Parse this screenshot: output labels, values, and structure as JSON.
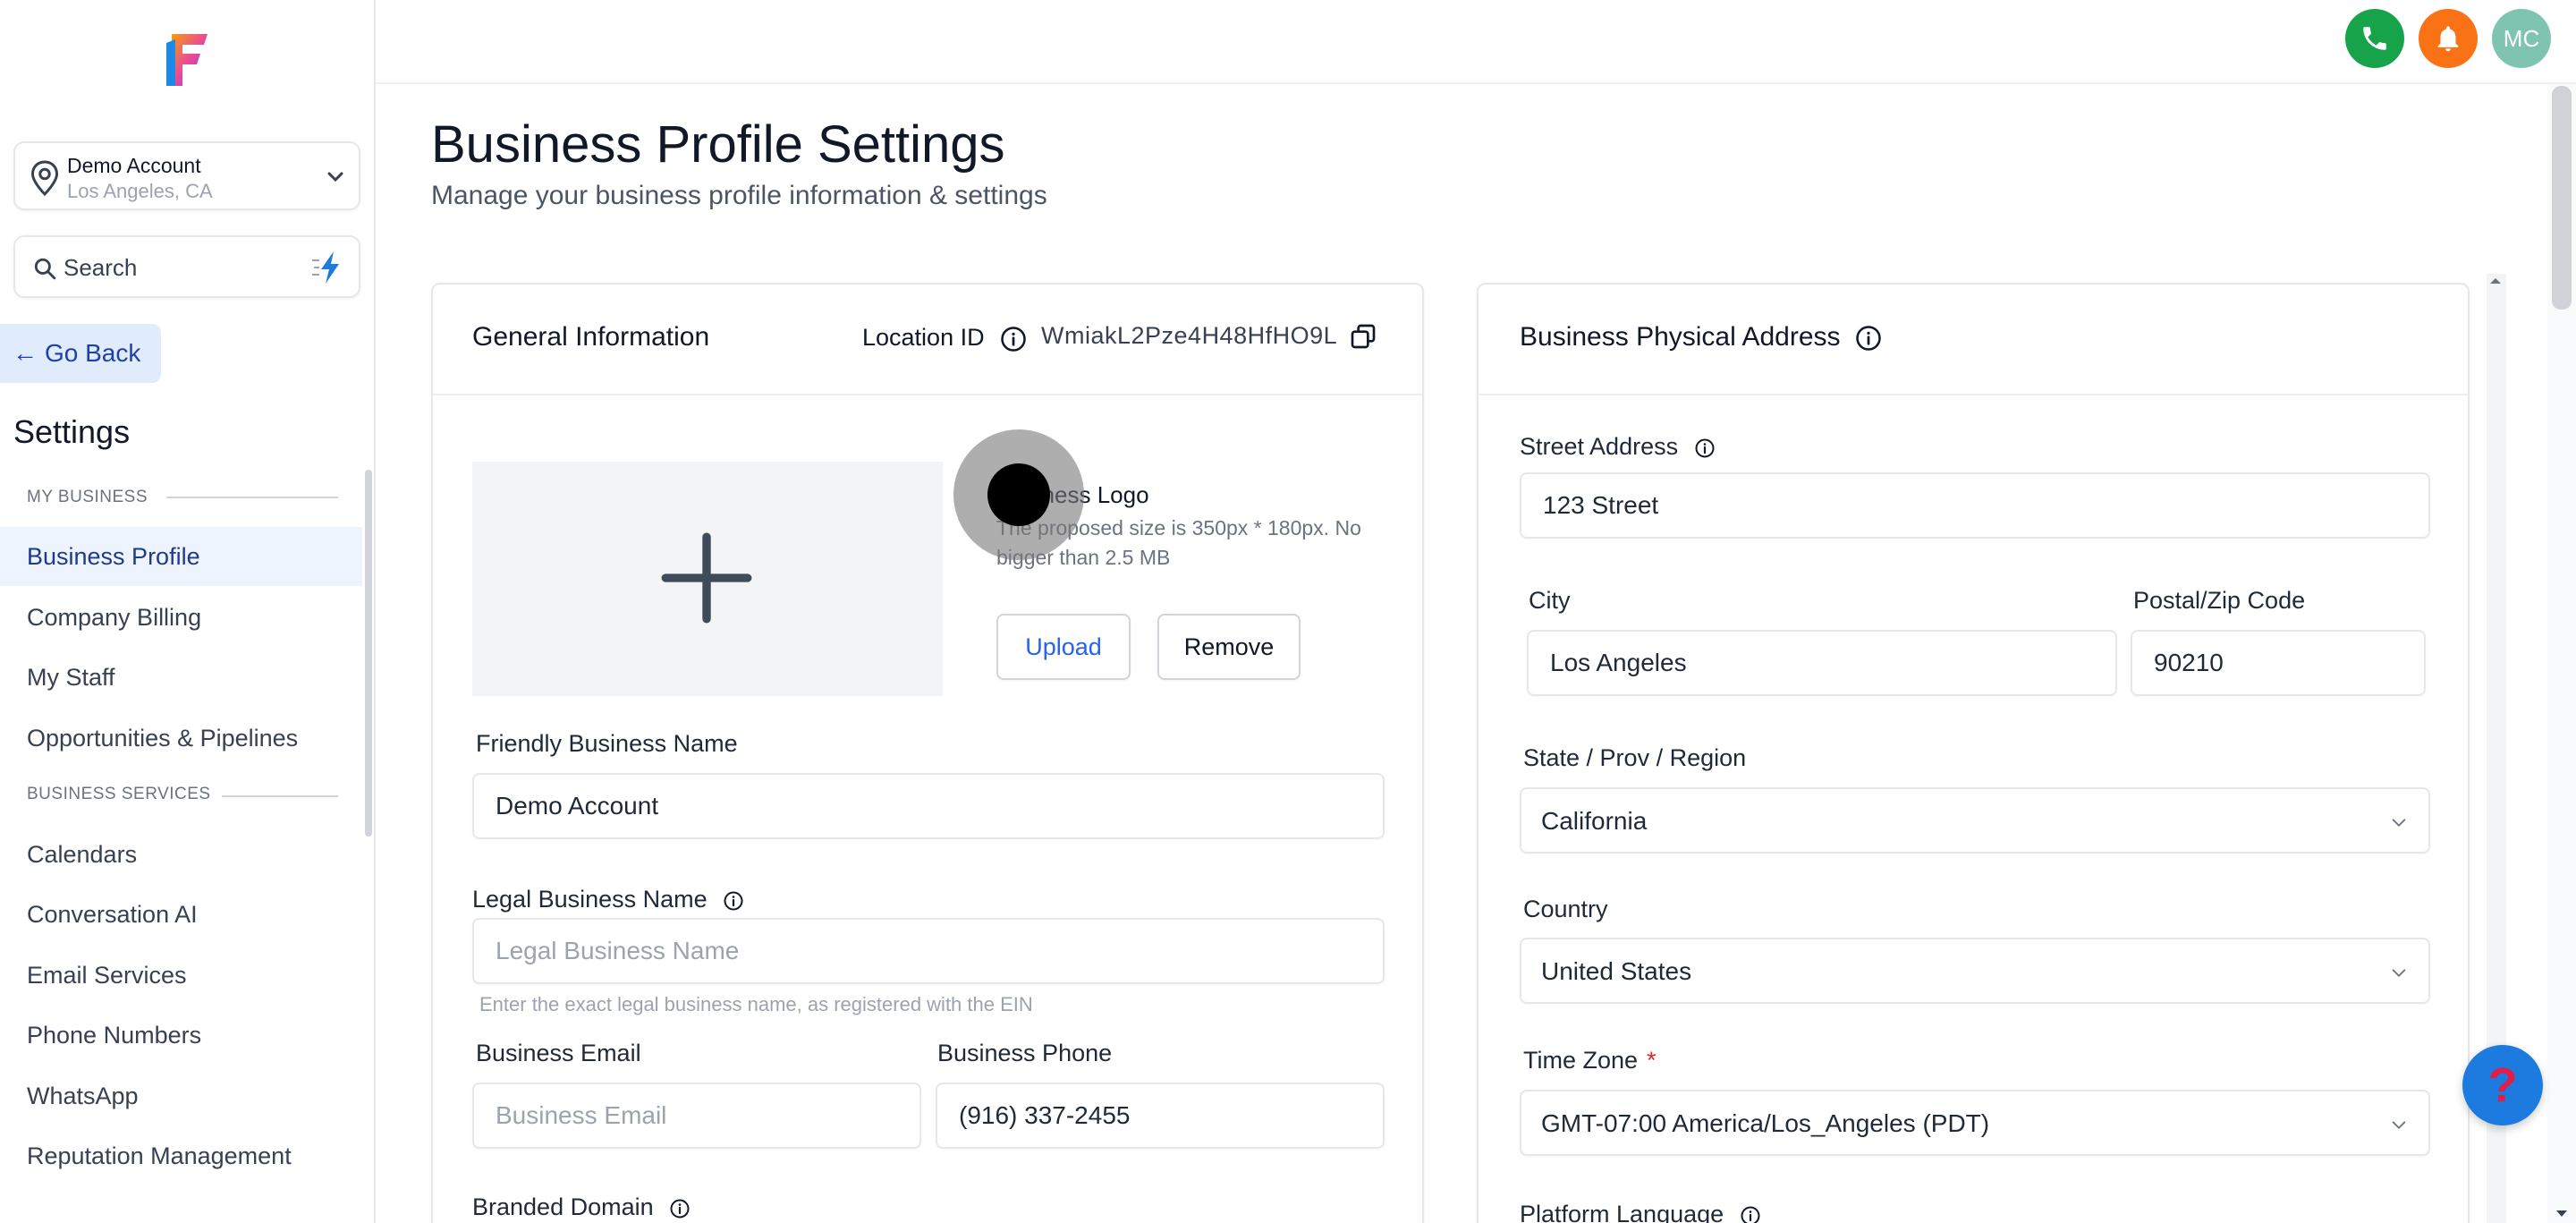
{
  "sidebar": {
    "account": {
      "name": "Demo Account",
      "location": "Los Angeles, CA"
    },
    "search": {
      "placeholder": "Search"
    },
    "go_back": "Go Back",
    "settings_title": "Settings",
    "sections": [
      {
        "label": "MY BUSINESS"
      },
      {
        "label": "BUSINESS SERVICES"
      }
    ],
    "items": [
      {
        "label": "Business Profile",
        "active": true
      },
      {
        "label": "Company Billing"
      },
      {
        "label": "My Staff"
      },
      {
        "label": "Opportunities & Pipelines"
      },
      {
        "label": "Calendars"
      },
      {
        "label": "Conversation AI"
      },
      {
        "label": "Email Services"
      },
      {
        "label": "Phone Numbers"
      },
      {
        "label": "WhatsApp"
      },
      {
        "label": "Reputation Management"
      }
    ]
  },
  "topbar": {
    "avatar_initials": "MC"
  },
  "page": {
    "title": "Business Profile Settings",
    "subtitle": "Manage your business profile information & settings"
  },
  "general": {
    "title": "General Information",
    "location_label": "Location ID",
    "location_id": "WmiakL2Pze4H48HfHO9L",
    "logo_title": "Business Logo",
    "logo_hint": "The proposed size is 350px * 180px. No bigger than 2.5 MB",
    "upload_label": "Upload",
    "remove_label": "Remove",
    "friendly_name_label": "Friendly Business Name",
    "friendly_name_value": "Demo Account",
    "legal_name_label": "Legal Business Name",
    "legal_name_placeholder": "Legal Business Name",
    "legal_name_help": "Enter the exact legal business name, as registered with the EIN",
    "email_label": "Business Email",
    "email_placeholder": "Business Email",
    "phone_label": "Business Phone",
    "phone_value": "(916) 337-2455",
    "branded_domain_label": "Branded Domain"
  },
  "address": {
    "title": "Business Physical Address",
    "street_label": "Street Address",
    "street_value": "123 Street",
    "city_label": "City",
    "city_value": "Los Angeles",
    "zip_label": "Postal/Zip Code",
    "zip_value": "90210",
    "state_label": "State / Prov / Region",
    "state_value": "California",
    "country_label": "Country",
    "country_value": "United States",
    "timezone_label": "Time Zone",
    "timezone_required": "*",
    "timezone_value": "GMT-07:00 America/Los_Angeles (PDT)",
    "language_label": "Platform Language"
  },
  "help_button": "?",
  "colors": {
    "accent": "#2563eb",
    "active_nav_bg": "#eef4fd",
    "phone_green": "#16a34a",
    "bell_orange": "#f97316",
    "avatar_teal": "#7fc4b0"
  }
}
